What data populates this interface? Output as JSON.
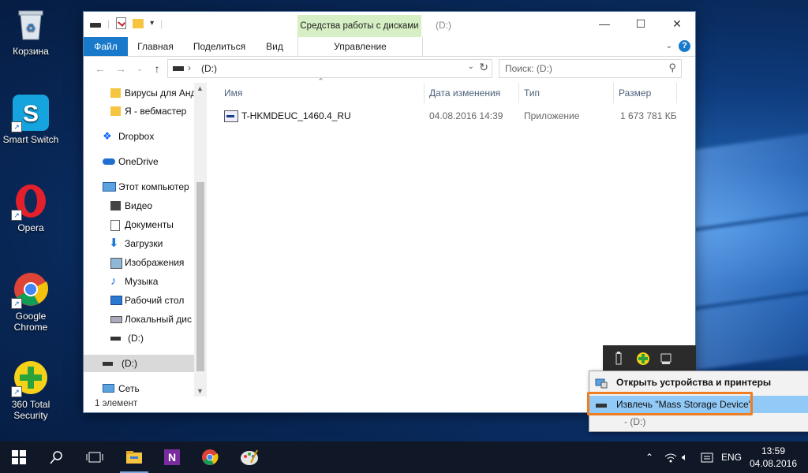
{
  "desktop": {
    "icons": [
      {
        "label": "Корзина"
      },
      {
        "label": "Smart Switch"
      },
      {
        "label": "Opera"
      },
      {
        "label": "Google Chrome",
        "line1": "Google",
        "line2": "Chrome"
      },
      {
        "label": "360 Total Security",
        "line1": "360 Total",
        "line2": "Security"
      }
    ]
  },
  "explorer": {
    "title": "(D:)",
    "contextual_tab_group": "Средства работы с дисками",
    "ribbon_tabs": {
      "file": "Файл",
      "home": "Главная",
      "share": "Поделиться",
      "view": "Вид",
      "manage": "Управление"
    },
    "window_buttons": {
      "minimize": "—",
      "maximize": "☐",
      "close": "✕"
    },
    "address": {
      "path": "(D:)"
    },
    "search": {
      "placeholder": "Поиск: (D:)"
    },
    "nav_items": [
      {
        "label": "Вирусы для Анд",
        "icon": "folder-icon"
      },
      {
        "label": "Я - вебмастер",
        "icon": "folder-icon"
      },
      {
        "label": "Dropbox",
        "icon": "dropbox-icon"
      },
      {
        "label": "OneDrive",
        "icon": "onedrive-icon"
      },
      {
        "label": "Этот компьютер",
        "icon": "computer-icon"
      },
      {
        "label": "Видео",
        "icon": "video-icon"
      },
      {
        "label": "Документы",
        "icon": "documents-icon"
      },
      {
        "label": "Загрузки",
        "icon": "downloads-icon"
      },
      {
        "label": "Изображения",
        "icon": "pictures-icon"
      },
      {
        "label": "Музыка",
        "icon": "music-icon"
      },
      {
        "label": "Рабочий стол",
        "icon": "desktop-icon"
      },
      {
        "label": "Локальный дис",
        "icon": "local-disk-icon"
      },
      {
        "label": "(D:)",
        "icon": "drive-icon"
      },
      {
        "label": "(D:)",
        "icon": "drive-icon",
        "selected": true
      },
      {
        "label": "Сеть",
        "icon": "network-icon"
      }
    ],
    "columns": {
      "name": "Имя",
      "date": "Дата изменения",
      "type": "Тип",
      "size": "Размер"
    },
    "files": [
      {
        "name": "T-HKMDEUC_1460.4_RU",
        "date": "04.08.2016 14:39",
        "type": "Приложение",
        "size": "1 673 781 КБ"
      }
    ],
    "status": "1 элемент"
  },
  "tray_menu": {
    "items": [
      {
        "label": "Открыть устройства и принтеры"
      },
      {
        "label": "Извлечь \"Mass Storage Device\"",
        "highlighted": true
      },
      {
        "label": "- (D:)"
      }
    ]
  },
  "taskbar": {
    "language": "ENG",
    "time": "13:59",
    "date": "04.08.2016"
  },
  "colors": {
    "accent": "#1979ca",
    "contextual_tab": "#d6efc4",
    "menu_highlight": "#91c9f7",
    "annotation_frame": "#ef7d22",
    "taskbar": "#101827"
  }
}
